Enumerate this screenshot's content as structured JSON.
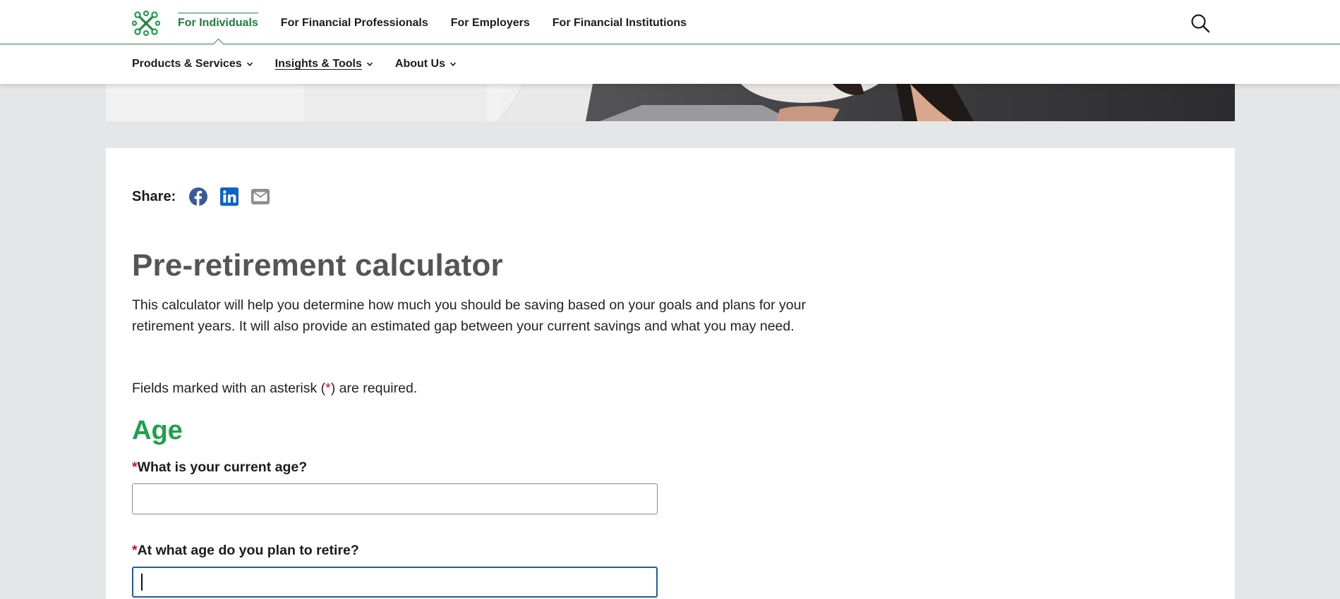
{
  "nav": {
    "audience_tabs": [
      {
        "label": "For Individuals",
        "active": true
      },
      {
        "label": "For Financial Professionals",
        "active": false
      },
      {
        "label": "For Employers",
        "active": false
      },
      {
        "label": "For Financial Institutions",
        "active": false
      }
    ],
    "search_icon": "search-icon",
    "sub_menu": [
      {
        "label": "Products & Services",
        "current": false
      },
      {
        "label": "Insights & Tools",
        "current": true
      },
      {
        "label": "About Us",
        "current": false
      }
    ]
  },
  "share": {
    "label": "Share:",
    "icons": [
      "facebook-icon",
      "linkedin-icon",
      "email-icon"
    ]
  },
  "main": {
    "title": "Pre-retirement calculator",
    "intro": "This calculator will help you determine how much you should be saving based on your goals and plans for your retirement years. It will also provide an estimated gap between your current savings and what you may need.",
    "required_note": {
      "before": "Fields marked with an asterisk (",
      "star": "*",
      "after": ") are required."
    },
    "section_title": "Age",
    "fields": [
      {
        "star": "*",
        "label": "What is your current age?",
        "value": ""
      },
      {
        "star": "*",
        "label": "At what age do you plan to retire?",
        "value": ""
      }
    ]
  },
  "colors": {
    "brand_green": "#1fa14b",
    "active_nav_green": "#1e7d3c",
    "title_gray": "#555555",
    "required_red": "#c8102e",
    "focus_blue": "#1a5fa0",
    "facebook_blue": "#3b5998",
    "linkedin_blue": "#0a66c2",
    "email_gray": "#8c8c8c"
  }
}
